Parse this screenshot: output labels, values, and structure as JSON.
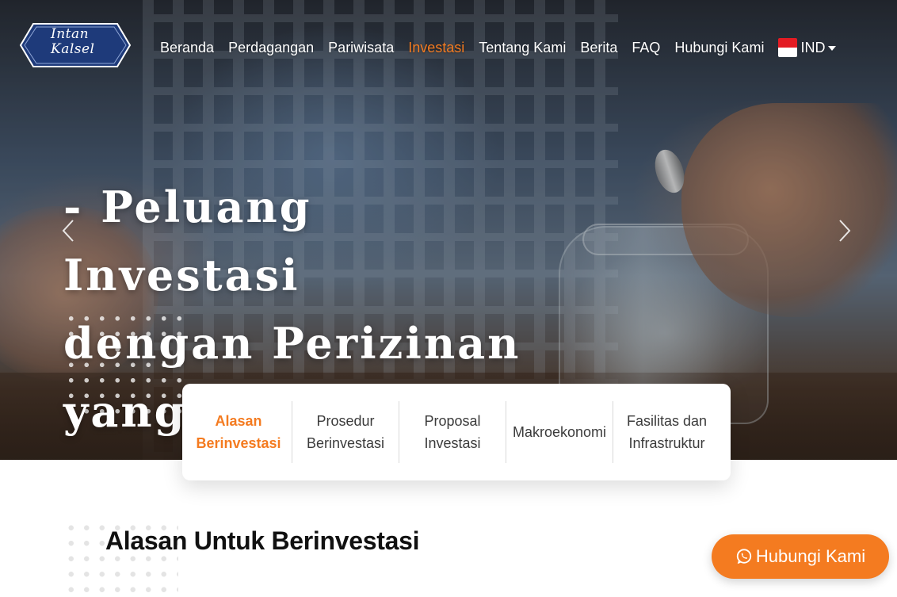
{
  "brand": {
    "logo_line1": "Intan",
    "logo_line2": "Kalsel"
  },
  "nav": {
    "items": [
      {
        "label": "Beranda",
        "active": false
      },
      {
        "label": "Perdagangan",
        "active": false
      },
      {
        "label": "Pariwisata",
        "active": false
      },
      {
        "label": "Investasi",
        "active": true
      },
      {
        "label": "Tentang Kami",
        "active": false
      },
      {
        "label": "Berita",
        "active": false
      },
      {
        "label": "FAQ",
        "active": false
      },
      {
        "label": "Hubungi Kami",
        "active": false
      }
    ],
    "language": "IND",
    "accent_color": "#f47b20"
  },
  "hero": {
    "headline_line1": "- Peluang Investasi",
    "headline_line2": "dengan Perizinan",
    "headline_line3": "yang mudah"
  },
  "tabs": [
    {
      "line1": "Alasan",
      "line2": "Berinvestasi",
      "active": true
    },
    {
      "line1": "Prosedur",
      "line2": "Berinvestasi",
      "active": false
    },
    {
      "line1": "Proposal",
      "line2": "Investasi",
      "active": false
    },
    {
      "line1": "Makroekonomi",
      "line2": "",
      "active": false
    },
    {
      "line1": "Fasilitas dan",
      "line2": "Infrastruktur",
      "active": false
    }
  ],
  "section": {
    "title": "Alasan Untuk Berinvestasi"
  },
  "contact_button": {
    "label": "Hubungi Kami",
    "icon": "whatsapp-icon"
  }
}
